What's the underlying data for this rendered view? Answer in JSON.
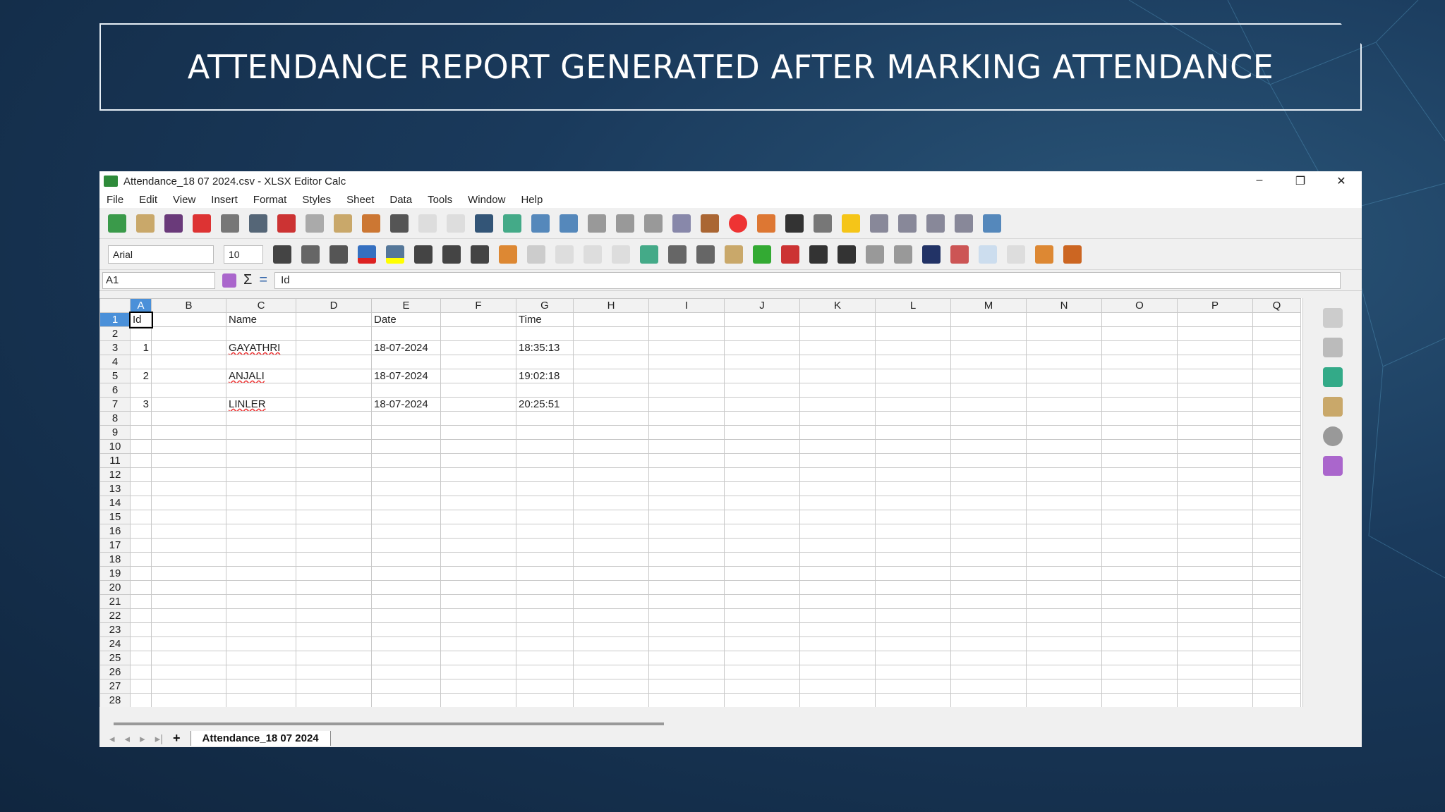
{
  "slide": {
    "title": "ATTENDANCE REPORT GENERATED AFTER MARKING ATTENDANCE"
  },
  "window": {
    "title": "Attendance_18 07 2024.csv - XLSX Editor Calc",
    "minimize": "–",
    "maximize": "❐",
    "close": "✕"
  },
  "menu": [
    "File",
    "Edit",
    "View",
    "Insert",
    "Format",
    "Styles",
    "Sheet",
    "Data",
    "Tools",
    "Window",
    "Help"
  ],
  "format": {
    "font": "Arial",
    "size": "10"
  },
  "formula": {
    "cell_ref": "A1",
    "sum": "Σ",
    "equals": "=",
    "content": "Id"
  },
  "columns": [
    "A",
    "B",
    "C",
    "D",
    "E",
    "F",
    "G",
    "H",
    "I",
    "J",
    "K",
    "L",
    "M",
    "N",
    "O",
    "P",
    "Q"
  ],
  "row_count": 29,
  "cells": {
    "1": {
      "A": "Id",
      "C": "Name",
      "E": "Date",
      "G": "Time"
    },
    "3": {
      "A": "1",
      "C": "GAYATHRI",
      "E": "18-07-2024",
      "G": "18:35:13"
    },
    "5": {
      "A": "2",
      "C": "ANJALI",
      "E": "18-07-2024",
      "G": "19:02:18"
    },
    "7": {
      "A": "3",
      "C": "LINLER",
      "E": "18-07-2024",
      "G": "20:25:51"
    }
  },
  "sheet_tabs": {
    "add": "+",
    "active": "Attendance_18 07 2024",
    "nav": [
      "◂",
      "◂",
      "▸",
      "▸|"
    ]
  }
}
